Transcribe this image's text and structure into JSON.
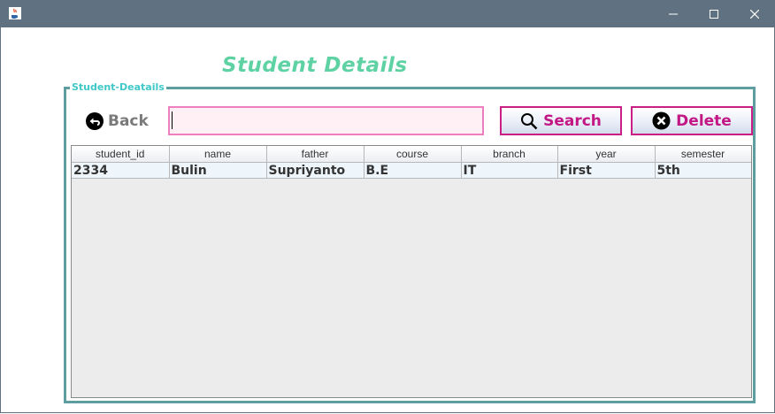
{
  "window": {
    "title": "",
    "colors": {
      "titlebar": "#607182",
      "accent": "#5f9ea0"
    }
  },
  "page": {
    "title": "Student Details",
    "group_label": "Student-Deatails"
  },
  "toolbar": {
    "back_label": "Back",
    "search_value": "",
    "search_placeholder": "",
    "search_label": "Search",
    "delete_label": "Delete"
  },
  "table": {
    "columns": [
      "student_id",
      "name",
      "father",
      "course",
      "branch",
      "year",
      "semester"
    ],
    "rows": [
      [
        "2334",
        "Bulin",
        "Supriyanto",
        "B.E",
        "IT",
        "First",
        "5th"
      ]
    ]
  },
  "icons": {
    "back": "back-arrow-circle-icon",
    "search": "magnifier-icon",
    "delete": "close-circle-icon",
    "app": "java-cup-icon"
  }
}
